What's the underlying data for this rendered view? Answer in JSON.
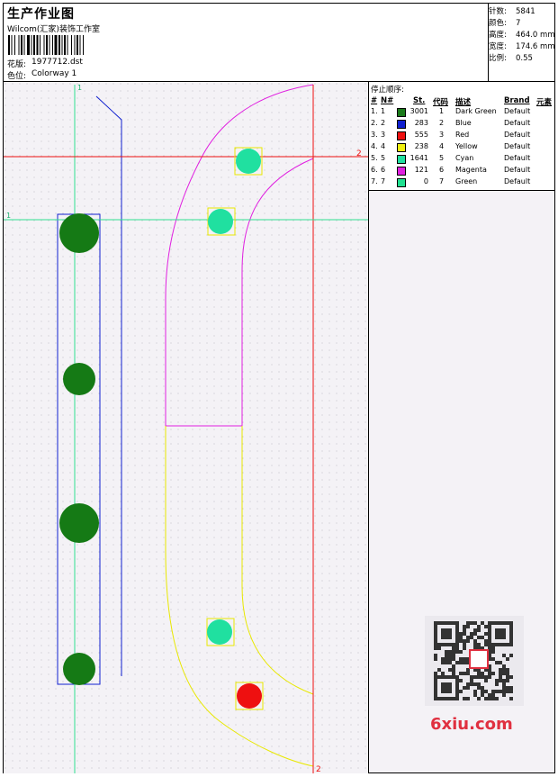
{
  "header": {
    "title": "生产作业图",
    "subtitle": "Wilcom(汇家)装饰工作室",
    "design_label": "花版:",
    "design_value": "1977712.dst",
    "colorway_label": "色位:",
    "colorway_value": "Colorway 1"
  },
  "stats": [
    {
      "label": "针数:",
      "value": "5841"
    },
    {
      "label": "颜色:",
      "value": "7"
    },
    {
      "label": "高度:",
      "value": "464.0 mm"
    },
    {
      "label": "宽度:",
      "value": "174.6 mm"
    },
    {
      "label": "比例:",
      "value": "0.55"
    }
  ],
  "stop_sequence": {
    "title": "停止顺序:",
    "headers": {
      "num": "#",
      "needle": "N#",
      "stitches": "St.",
      "code": "代码",
      "desc": "描述",
      "brand": "Brand",
      "element": "元素"
    },
    "rows": [
      {
        "num": "1.",
        "needle": "1",
        "color": "#1a7a1a",
        "stitches": "3001",
        "code": "1",
        "desc": "Dark Green",
        "brand": "Default"
      },
      {
        "num": "2.",
        "needle": "2",
        "color": "#1020d0",
        "stitches": "283",
        "code": "2",
        "desc": "Blue",
        "brand": "Default"
      },
      {
        "num": "3.",
        "needle": "3",
        "color": "#ee1010",
        "stitches": "555",
        "code": "3",
        "desc": "Red",
        "brand": "Default"
      },
      {
        "num": "4.",
        "needle": "4",
        "color": "#f0f010",
        "stitches": "238",
        "code": "4",
        "desc": "Yellow",
        "brand": "Default"
      },
      {
        "num": "5.",
        "needle": "5",
        "color": "#20e0a0",
        "stitches": "1641",
        "code": "5",
        "desc": "Cyan",
        "brand": "Default"
      },
      {
        "num": "6.",
        "needle": "6",
        "color": "#e020e0",
        "stitches": "121",
        "code": "6",
        "desc": "Magenta",
        "brand": "Default"
      },
      {
        "num": "7.",
        "needle": "7",
        "color": "#20e090",
        "stitches": "0",
        "code": "7",
        "desc": "Green",
        "brand": "Default"
      }
    ]
  },
  "guides": {
    "v1": "1",
    "h1": "1",
    "h2": "2",
    "v2": "2"
  },
  "watermark": "6xiu.com"
}
